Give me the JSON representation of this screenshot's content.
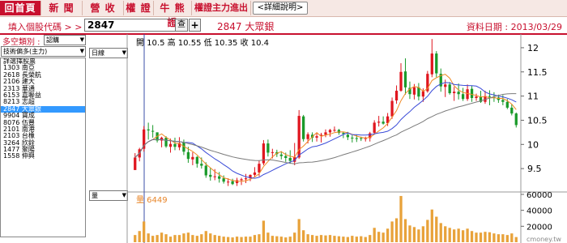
{
  "tabs": [
    {
      "label": "回首頁",
      "active": true
    },
    {
      "label": "新 聞",
      "active": false
    },
    {
      "label": "營 收",
      "active": false
    },
    {
      "label": "權 證",
      "active": false
    },
    {
      "label": "牛 熊 證",
      "active": false
    },
    {
      "label": "權證主力進出",
      "active": false
    }
  ],
  "detail_button": "<詳細說明>",
  "search": {
    "label": "填入個股代碼 > >",
    "value": "2847",
    "query_button": "查",
    "add_button": "+"
  },
  "stock_title": "2847 大眾銀",
  "data_date": "資料日期 : 2013/03/29",
  "left_panel": {
    "category_label": "多空類別 :",
    "category_value": "認購",
    "filter_value": "技術偏多(主力)",
    "stocks": [
      "詳選擇股票",
      "1303 南亞",
      "2618 長榮航",
      "2106 建大",
      "2313 華通",
      "6153 嘉聯益",
      "8213 志超",
      "2847 大眾銀",
      "9904 寶成",
      "8076 伍豐",
      "2101 南港",
      "2103 台橡",
      "3264 欣銓",
      "1477 聚陽",
      "1558 伸興"
    ],
    "selected_stock": "2847 大眾銀"
  },
  "mid_panel": {
    "period_value": "日線",
    "indicator_value": "量"
  },
  "chart_data": {
    "type": "candlestick",
    "title": "開 10.5  高 10.55  低 10.35  收 10.4",
    "volume_label": "量 6449",
    "y_ticks": [
      12,
      11.5,
      11,
      10.5,
      10,
      9.5
    ],
    "ylim": [
      9.05,
      12.25
    ],
    "volume_ticks": [
      "60000",
      "40000",
      "20000"
    ],
    "volume_max": 62000,
    "watermark": "cmoney.tw",
    "candles": [
      [
        9.47,
        9.82,
        9.56,
        9.73
      ],
      [
        9.73,
        9.93,
        9.65,
        9.9
      ],
      [
        9.91,
        10.38,
        9.85,
        10.31
      ],
      [
        10.31,
        10.45,
        10.1,
        10.29
      ],
      [
        10.28,
        10.4,
        10.14,
        10.27
      ],
      [
        10.25,
        10.25,
        10.04,
        10.08
      ],
      [
        10.08,
        10.16,
        9.94,
        10.14
      ],
      [
        10.14,
        10.17,
        9.93,
        9.96
      ],
      [
        9.95,
        10.12,
        9.83,
        10.01
      ],
      [
        10.01,
        10.14,
        9.88,
        9.95
      ],
      [
        9.94,
        10.15,
        9.88,
        10.03
      ],
      [
        10.04,
        10.1,
        9.78,
        9.85
      ],
      [
        9.84,
        9.95,
        9.62,
        9.7
      ],
      [
        9.69,
        9.84,
        9.57,
        9.74
      ],
      [
        9.74,
        9.76,
        9.52,
        9.6
      ],
      [
        9.6,
        9.73,
        9.5,
        9.56
      ],
      [
        9.56,
        9.63,
        9.31,
        9.36
      ],
      [
        9.37,
        9.52,
        9.25,
        9.33
      ],
      [
        9.34,
        9.49,
        9.26,
        9.34
      ],
      [
        9.34,
        9.43,
        9.21,
        9.29
      ],
      [
        9.3,
        9.36,
        9.19,
        9.23
      ],
      [
        9.23,
        9.3,
        9.14,
        9.23
      ],
      [
        9.24,
        9.29,
        9.16,
        9.18
      ],
      [
        9.2,
        9.31,
        9.14,
        9.26
      ],
      [
        9.26,
        9.31,
        9.16,
        9.28
      ],
      [
        9.28,
        9.39,
        9.2,
        9.3
      ],
      [
        9.3,
        9.38,
        9.24,
        9.37
      ],
      [
        9.37,
        9.53,
        9.32,
        9.42
      ],
      [
        9.42,
        9.66,
        9.34,
        9.6
      ],
      [
        9.61,
        10.09,
        9.57,
        10.02
      ],
      [
        10.02,
        10.1,
        9.75,
        9.83
      ],
      [
        9.83,
        9.91,
        9.71,
        9.84
      ],
      [
        9.84,
        9.89,
        9.74,
        9.8
      ],
      [
        9.79,
        9.86,
        9.69,
        9.76
      ],
      [
        9.76,
        9.83,
        9.64,
        9.72
      ],
      [
        9.72,
        9.88,
        9.6,
        9.66
      ],
      [
        9.64,
        10.03,
        9.57,
        9.74
      ],
      [
        9.73,
        10.71,
        9.7,
        10.59
      ],
      [
        10.58,
        10.61,
        10.06,
        10.11
      ],
      [
        10.11,
        10.25,
        10.02,
        10.21
      ],
      [
        10.2,
        10.25,
        10.05,
        10.14
      ],
      [
        10.14,
        10.23,
        10.06,
        10.17
      ],
      [
        10.18,
        10.24,
        10.04,
        10.2
      ],
      [
        10.2,
        10.31,
        10.15,
        10.25
      ],
      [
        10.25,
        10.32,
        10.16,
        10.3
      ],
      [
        10.29,
        10.37,
        10.26,
        10.3
      ],
      [
        10.3,
        10.32,
        10.2,
        10.24
      ],
      [
        10.24,
        10.26,
        10.13,
        10.22
      ],
      [
        10.2,
        10.26,
        10.09,
        10.15
      ],
      [
        10.14,
        10.19,
        10.04,
        10.13
      ],
      [
        10.13,
        10.2,
        10.05,
        10.12
      ],
      [
        10.13,
        10.16,
        10.07,
        10.12
      ],
      [
        10.12,
        10.16,
        10.06,
        10.13
      ],
      [
        10.13,
        10.26,
        10.06,
        10.23
      ],
      [
        10.24,
        10.5,
        10.21,
        10.45
      ],
      [
        10.45,
        10.59,
        10.37,
        10.47
      ],
      [
        10.47,
        10.58,
        10.41,
        10.43
      ],
      [
        10.44,
        10.65,
        10.38,
        10.58
      ],
      [
        10.58,
        10.97,
        10.53,
        10.9
      ],
      [
        10.91,
        11.22,
        10.84,
        11.11
      ],
      [
        11.11,
        11.68,
        11.09,
        11.5
      ],
      [
        11.51,
        11.78,
        11.03,
        11.18
      ],
      [
        11.17,
        11.3,
        10.94,
        11.04
      ],
      [
        11.03,
        11.25,
        10.93,
        11.18
      ],
      [
        11.18,
        11.27,
        10.91,
        10.99
      ],
      [
        10.99,
        11.16,
        10.88,
        11.1
      ],
      [
        11.1,
        11.52,
        11.07,
        11.46
      ],
      [
        11.45,
        12.18,
        11.39,
        11.88
      ],
      [
        11.88,
        11.93,
        11.39,
        11.47
      ],
      [
        11.46,
        11.57,
        11.09,
        11.2
      ],
      [
        11.19,
        11.34,
        10.98,
        11.24
      ],
      [
        11.24,
        11.29,
        11.03,
        11.06
      ],
      [
        11.06,
        11.19,
        10.9,
        11.09
      ],
      [
        11.09,
        11.26,
        10.93,
        11.04
      ],
      [
        11.04,
        11.17,
        10.9,
        10.94
      ],
      [
        10.94,
        11.24,
        10.9,
        11.14
      ],
      [
        11.15,
        11.22,
        10.88,
        10.96
      ],
      [
        10.96,
        11.05,
        10.9,
        10.99
      ],
      [
        10.99,
        11.11,
        10.86,
        10.88
      ],
      [
        10.88,
        11.11,
        10.84,
        11.0
      ],
      [
        11.0,
        11.12,
        10.81,
        10.99
      ],
      [
        10.98,
        11.08,
        10.88,
        10.97
      ],
      [
        10.97,
        11.03,
        10.86,
        10.92
      ],
      [
        10.92,
        11.02,
        10.81,
        10.88
      ],
      [
        10.88,
        10.94,
        10.73,
        10.76
      ],
      [
        10.76,
        10.83,
        10.6,
        10.64
      ],
      [
        10.64,
        10.66,
        10.35,
        10.4
      ]
    ],
    "volumes": [
      9000,
      14000,
      26000,
      11000,
      8000,
      9000,
      12000,
      10000,
      7000,
      9000,
      9000,
      11000,
      12000,
      9000,
      8000,
      10000,
      14000,
      11000,
      9000,
      8000,
      7000,
      6500,
      6000,
      7000,
      6500,
      7000,
      7000,
      9000,
      10000,
      27000,
      12000,
      8000,
      7500,
      7000,
      6000,
      7000,
      12000,
      29000,
      15000,
      10000,
      9000,
      8000,
      9000,
      8500,
      9000,
      8000,
      7500,
      7000,
      6500,
      8000,
      7000,
      7500,
      6500,
      9000,
      18000,
      13000,
      12000,
      17000,
      26000,
      30000,
      58000,
      29000,
      21000,
      19000,
      16000,
      20000,
      28000,
      41000,
      32000,
      24000,
      20000,
      18000,
      16000,
      17000,
      15000,
      17000,
      14000,
      12000,
      12000,
      13000,
      12500,
      11000,
      10000,
      10000,
      9000,
      11000,
      6449
    ]
  }
}
